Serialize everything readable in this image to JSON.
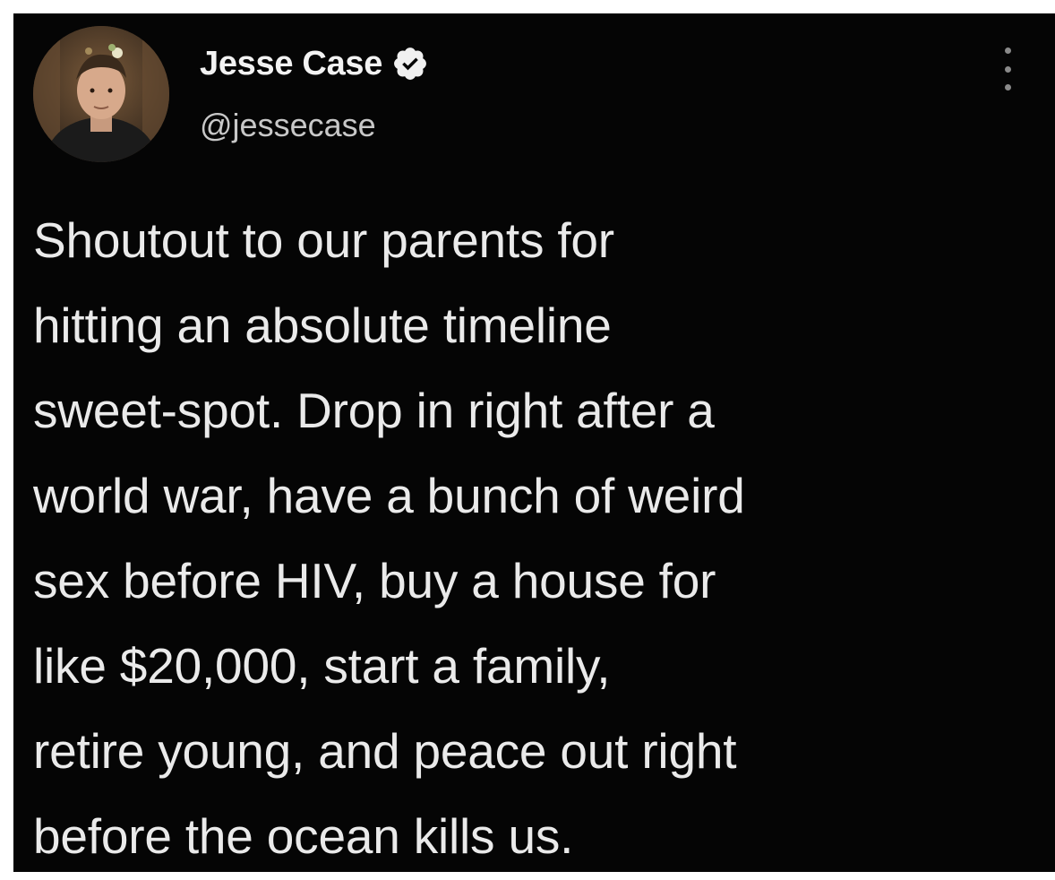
{
  "tweet": {
    "author_name": "Jesse Case",
    "author_handle": "@jessecase",
    "verified": true,
    "avatar_icon": "profile-photo",
    "more_icon": "more-vertical-icon",
    "text_lines": [
      "Shoutout to our parents for",
      "hitting an absolute timeline",
      "sweet-spot. Drop in right after a",
      "world war, have a bunch of weird",
      "sex before HIV, buy a house for",
      "like $20,000, start a family,",
      "retire young, and peace out right",
      "before the ocean kills us."
    ]
  },
  "colors": {
    "background": "#050505",
    "text": "#eaeaea",
    "handle": "#c8c8c8",
    "verified_badge": "#f0f0f0"
  }
}
